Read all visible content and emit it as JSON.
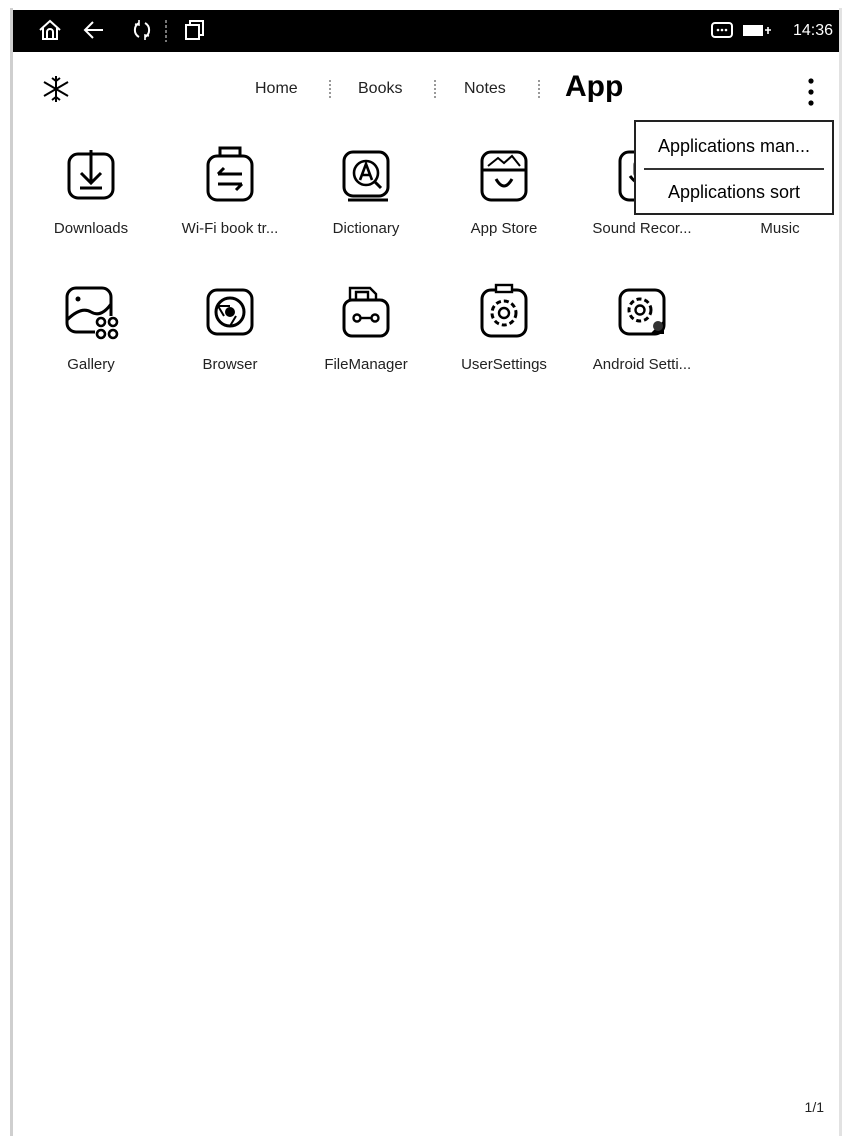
{
  "statusbar": {
    "time": "14:36"
  },
  "header": {
    "tabs": [
      {
        "label": "Home"
      },
      {
        "label": "Books"
      },
      {
        "label": "Notes"
      }
    ],
    "active_tab": "App"
  },
  "apps": [
    {
      "label": "Downloads"
    },
    {
      "label": "Wi-Fi book tr..."
    },
    {
      "label": "Dictionary"
    },
    {
      "label": "App Store"
    },
    {
      "label": "Sound Recor..."
    },
    {
      "label": "Music"
    },
    {
      "label": "Gallery"
    },
    {
      "label": "Browser"
    },
    {
      "label": "FileManager"
    },
    {
      "label": "UserSettings"
    },
    {
      "label": "Android Setti..."
    }
  ],
  "menu": {
    "items": [
      {
        "label": "Applications man..."
      },
      {
        "label": "Applications sort"
      }
    ]
  },
  "pager": {
    "text": "1/1"
  }
}
